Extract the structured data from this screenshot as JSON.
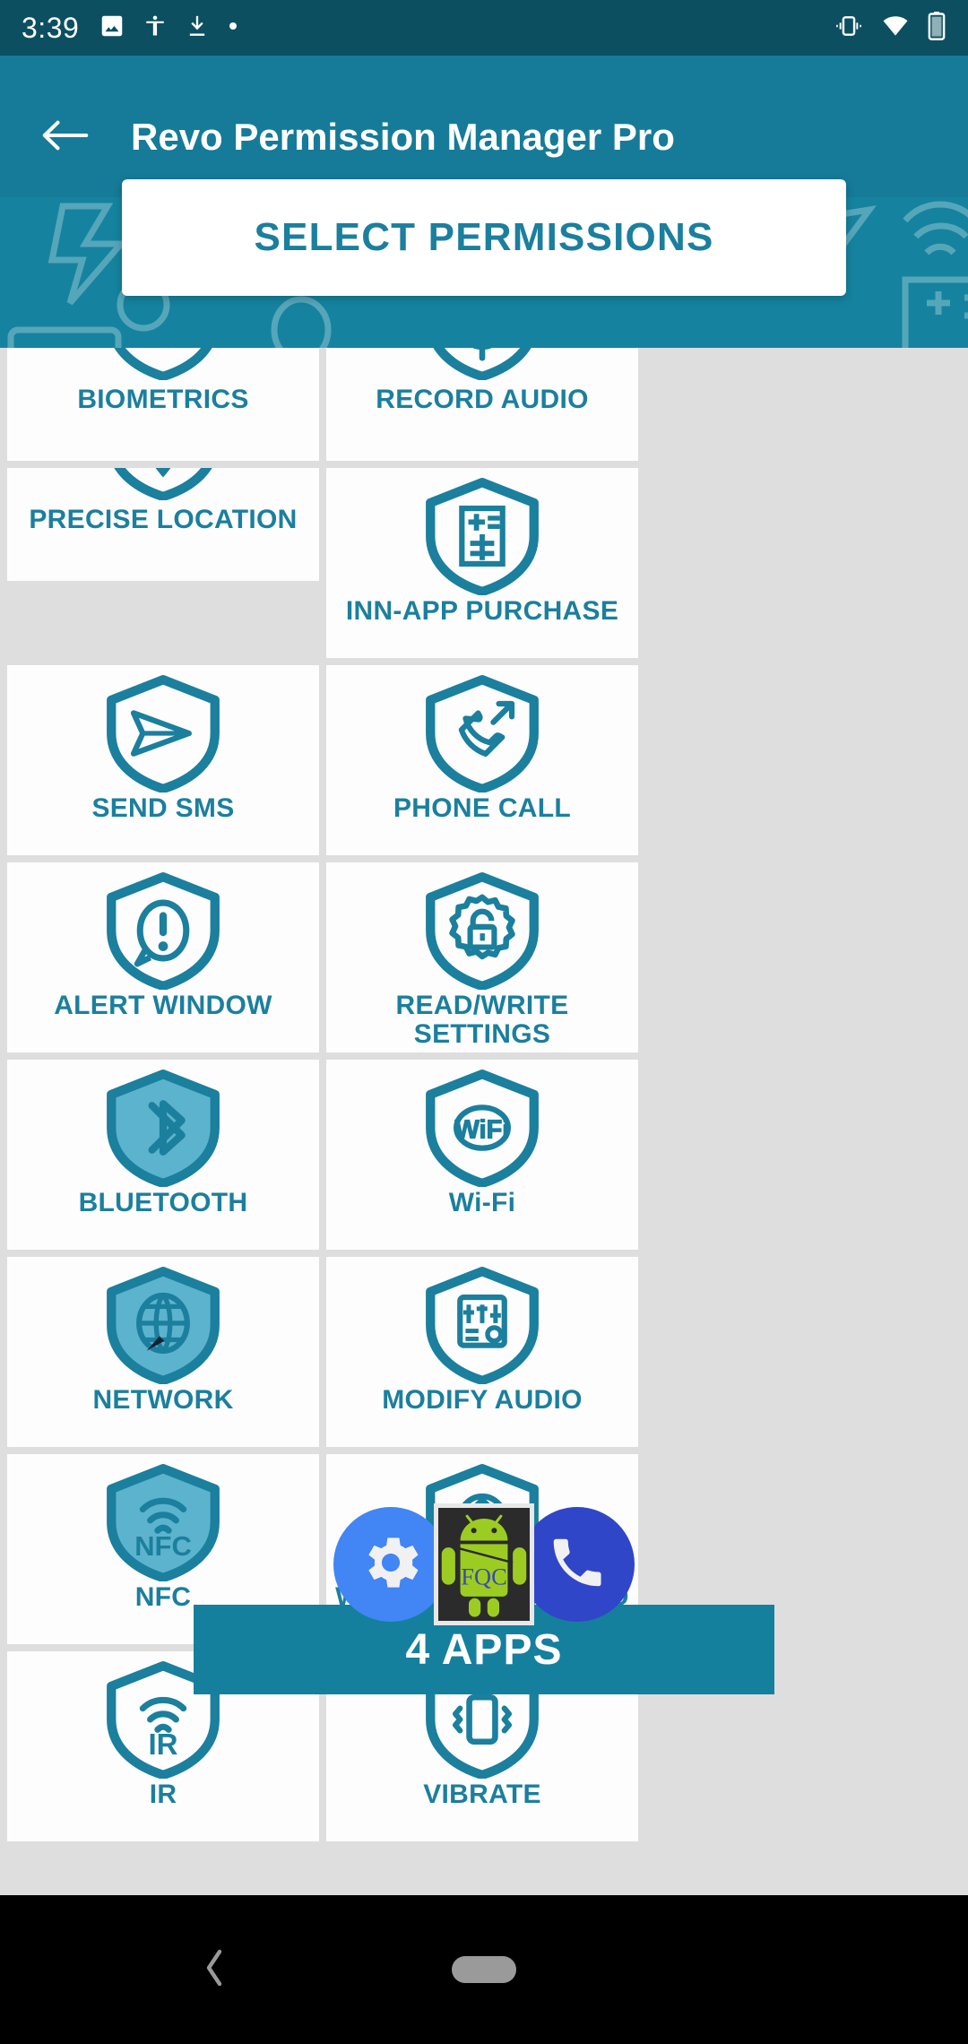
{
  "status_bar": {
    "time": "3:39",
    "left_icons": [
      "image-icon",
      "accessibility-icon",
      "download-icon",
      "dot-icon"
    ],
    "right_icons": [
      "vibrate-icon",
      "wifi-icon",
      "battery-icon"
    ],
    "background_color": "#0b4f61"
  },
  "app_bar": {
    "title": "Revo Permission Manager Pro",
    "back_icon": "arrow-left-icon",
    "background_color": "#157b99"
  },
  "select_card": {
    "label": "SELECT PERMISSIONS",
    "text_color": "#1b7f9e"
  },
  "theme": {
    "accent": "#1b7f9e",
    "accent_light": "#5cb3cd",
    "content_background": "#dedede",
    "tile_background": "#fdfdfd"
  },
  "permissions": [
    {
      "label": "BIOMETRICS",
      "icon": "shield-fingerprint-icon",
      "selected": false,
      "clipped": true
    },
    {
      "label": "RECORD AUDIO",
      "icon": "shield-microphone-icon",
      "selected": false,
      "clipped": true
    },
    {
      "label": "PRECISE LOCATION",
      "icon": "shield-location-icon",
      "selected": false,
      "clipped": true
    },
    {
      "label": "INN-APP PURCHASE",
      "icon": "shield-receipt-icon",
      "selected": false,
      "clipped": false
    },
    {
      "label": "SEND SMS",
      "icon": "shield-send-icon",
      "selected": false,
      "clipped": false
    },
    {
      "label": "PHONE CALL",
      "icon": "shield-phone-out-icon",
      "selected": false,
      "clipped": false
    },
    {
      "label": "ALERT WINDOW",
      "icon": "shield-alert-icon",
      "selected": false,
      "clipped": false
    },
    {
      "label": "READ/WRITE SETTINGS",
      "icon": "shield-gear-lock-icon",
      "selected": false,
      "clipped": false
    },
    {
      "label": "BLUETOOTH",
      "icon": "shield-bluetooth-icon",
      "selected": true,
      "clipped": false
    },
    {
      "label": "Wi-Fi",
      "icon": "shield-wifi-icon",
      "selected": false,
      "clipped": false
    },
    {
      "label": "NETWORK",
      "icon": "shield-globe-icon",
      "selected": true,
      "clipped": false
    },
    {
      "label": "MODIFY AUDIO",
      "icon": "shield-mixer-icon",
      "selected": false,
      "clipped": false
    },
    {
      "label": "NFC",
      "icon": "shield-nfc-icon",
      "selected": true,
      "clipped": false
    },
    {
      "label": "WORK BACKGROUND",
      "icon": "shield-refresh-icon",
      "selected": false,
      "clipped": false
    },
    {
      "label": "IR",
      "icon": "shield-ir-icon",
      "selected": false,
      "clipped": false
    },
    {
      "label": "VIBRATE",
      "icon": "shield-vibrate-icon",
      "selected": false,
      "clipped": false
    }
  ],
  "bottom_bar": {
    "apps_label": "4 APPS",
    "background_color": "#15809d",
    "left_fab_icon": "gear-icon",
    "right_fab_icon": "phone-icon",
    "app_thumbnail_label": "FQC",
    "app_thumbnail_icon": "android-robot-icon"
  },
  "nav_bar": {
    "back_icon": "nav-back-icon",
    "home_icon": "nav-home-pill-icon"
  }
}
